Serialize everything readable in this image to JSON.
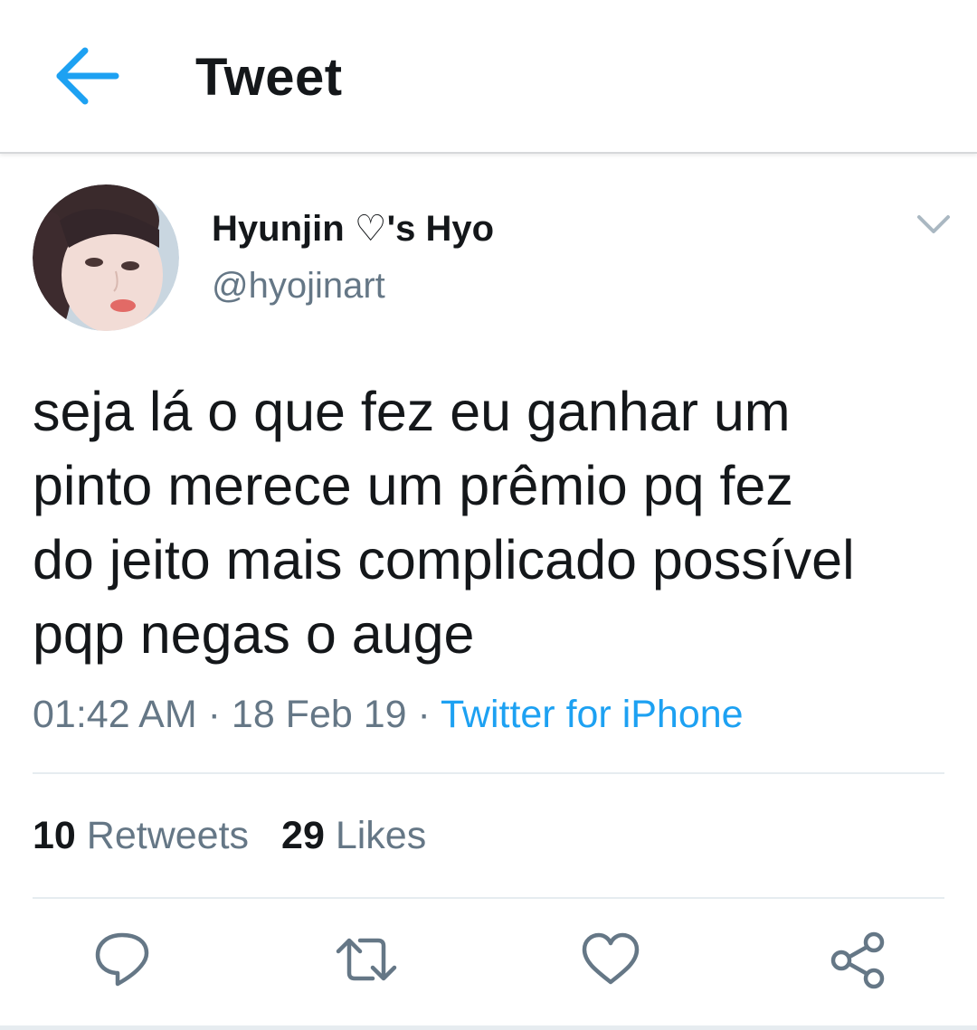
{
  "header": {
    "title": "Tweet",
    "back_icon": "arrow-left-icon"
  },
  "tweet": {
    "display_name": "Hyunjin ♡'s Hyo",
    "handle": "@hyojinart",
    "text": "seja lá o que fez eu ganhar um\npinto merece um prêmio pq fez\ndo jeito mais complicado possível\npqp negas o auge",
    "time": "01:42 AM",
    "date": "18 Feb 19",
    "separator": " · ",
    "source": "Twitter for iPhone",
    "retweets_count": "10",
    "retweets_label": "Retweets",
    "likes_count": "29",
    "likes_label": "Likes"
  },
  "actions": [
    {
      "icon": "reply-icon"
    },
    {
      "icon": "retweet-icon"
    },
    {
      "icon": "like-heart-icon"
    },
    {
      "icon": "share-icon"
    }
  ],
  "colors": {
    "accent": "#1da1f2",
    "text_primary": "#14171a",
    "text_secondary": "#657786",
    "divider": "#e6ecf0"
  }
}
